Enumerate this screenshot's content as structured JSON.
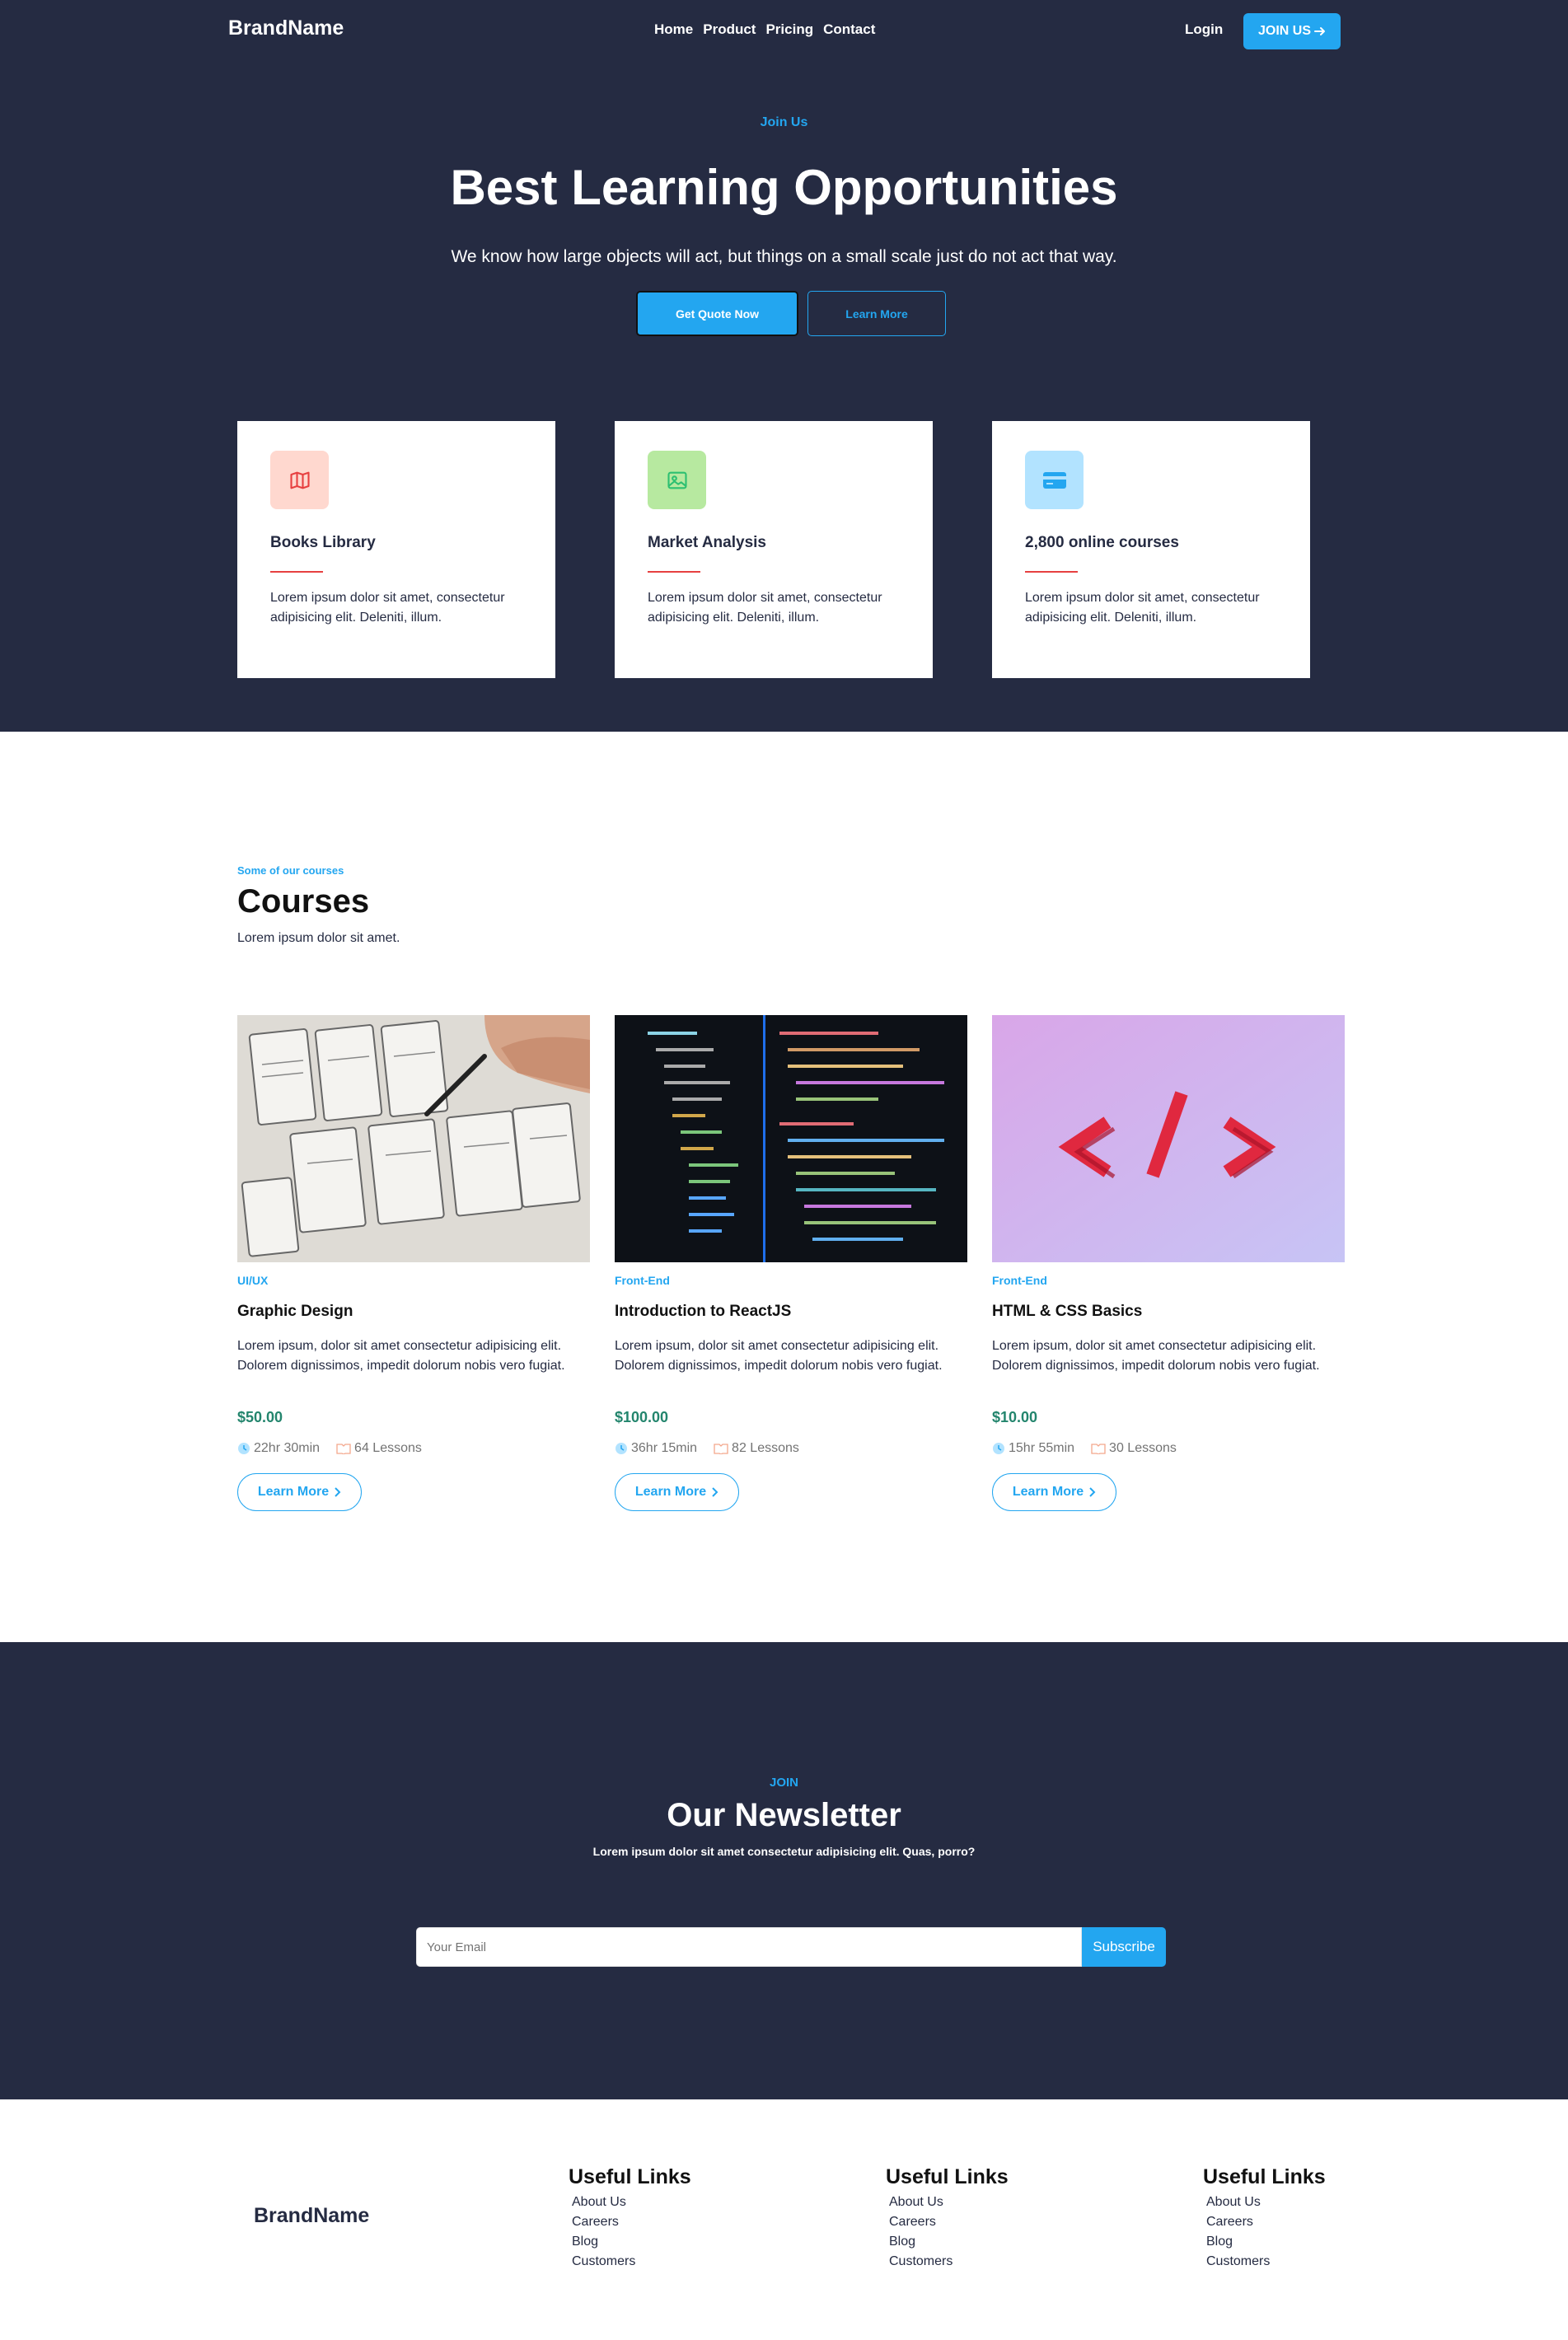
{
  "header": {
    "brand": "BrandName",
    "nav": [
      "Home",
      "Product",
      "Pricing",
      "Contact"
    ],
    "login_label": "Login",
    "join_label": "JOIN US"
  },
  "hero": {
    "eyebrow": "Join Us",
    "title": "Best Learning Opportunities",
    "subtitle": "We know how large objects will act, but things on a small scale just do not act that way.",
    "primary_cta": "Get Quote Now",
    "secondary_cta": "Learn More"
  },
  "features": [
    {
      "title": "Books Library",
      "text": "Lorem ipsum dolor sit amet, consectetur adipisicing elit. Deleniti, illum.",
      "icon": "map-icon",
      "icon_bg": "#ffd8cf",
      "icon_color": "#e74040"
    },
    {
      "title": "Market Analysis",
      "text": "Lorem ipsum dolor sit amet, consectetur adipisicing elit. Deleniti, illum.",
      "icon": "image-icon",
      "icon_bg": "#b7e9a0",
      "icon_color": "#2dc071"
    },
    {
      "title": "2,800 online courses",
      "text": "Lorem ipsum dolor sit amet, consectetur adipisicing elit. Deleniti, illum.",
      "icon": "card-icon",
      "icon_bg": "#b2e3ff",
      "icon_color": "#23a6f0"
    }
  ],
  "courses_section": {
    "eyebrow": "Some of our courses",
    "title": "Courses",
    "subtitle": "Lorem ipsum dolor sit amet."
  },
  "courses": [
    {
      "category": "UI/UX",
      "title": "Graphic Design",
      "description": "Lorem ipsum, dolor sit amet consectetur adipisicing elit. Dolorem dignissimos, impedit dolorum nobis vero fugiat.",
      "price": "$50.00",
      "duration": "22hr 30min",
      "lessons": "64 Lessons",
      "button": "Learn More"
    },
    {
      "category": "Front-End",
      "title": "Introduction to ReactJS",
      "description": "Lorem ipsum, dolor sit amet consectetur adipisicing elit. Dolorem dignissimos, impedit dolorum nobis vero fugiat.",
      "price": "$100.00",
      "duration": "36hr 15min",
      "lessons": "82 Lessons",
      "button": "Learn More"
    },
    {
      "category": "Front-End",
      "title": "HTML & CSS Basics",
      "description": "Lorem ipsum, dolor sit amet consectetur adipisicing elit. Dolorem dignissimos, impedit dolorum nobis vero fugiat.",
      "price": "$10.00",
      "duration": "15hr 55min",
      "lessons": "30 Lessons",
      "button": "Learn More"
    }
  ],
  "newsletter": {
    "eyebrow": "JOIN",
    "title": "Our Newsletter",
    "subtitle": "Lorem ipsum dolor sit amet consectetur adipisicing elit. Quas, porro?",
    "placeholder": "Your Email",
    "button": "Subscribe"
  },
  "footer": {
    "brand": "BrandName",
    "columns": [
      {
        "heading": "Useful Links",
        "links": [
          "About Us",
          "Careers",
          "Blog",
          "Customers"
        ]
      },
      {
        "heading": "Useful Links",
        "links": [
          "About Us",
          "Careers",
          "Blog",
          "Customers"
        ]
      },
      {
        "heading": "Useful Links",
        "links": [
          "About Us",
          "Careers",
          "Blog",
          "Customers"
        ]
      }
    ]
  },
  "colors": {
    "dark": "#252b42",
    "accent": "#23a6f0",
    "price": "#23856d",
    "underline": "#e74040"
  }
}
